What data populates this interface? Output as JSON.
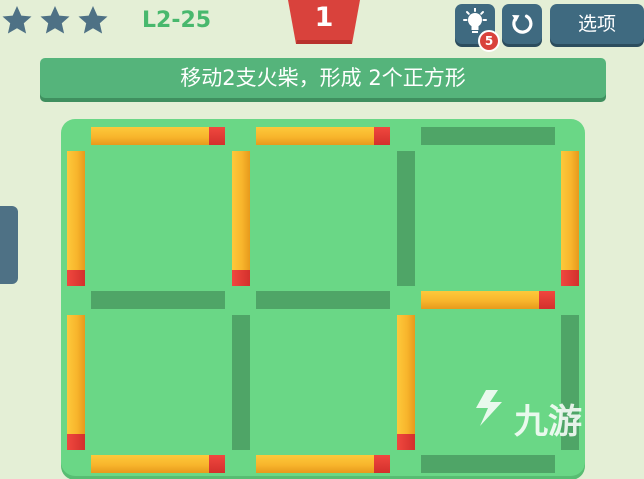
{
  "header": {
    "stars": [
      {
        "name": "star-1",
        "filled": true
      },
      {
        "name": "star-2",
        "filled": true
      },
      {
        "name": "star-3",
        "filled": true
      }
    ],
    "level": "L2-25",
    "moves": "1",
    "hint_count": "5",
    "options_label": "选项"
  },
  "instruction": "移动2支火柴，形成 2个正方形",
  "watermark": "九游",
  "colors": {
    "background": "#e4efd6",
    "star": "#4e7185",
    "level_text": "#48b86d",
    "move_banner": "#d9423c",
    "button": "#3f6a80",
    "instruction_bar": "#55b47b",
    "board": "#6ad786",
    "empty_slot": "#4fa567",
    "match_body": "#f8b52c",
    "match_head": "#d3302c"
  },
  "board": {
    "grid": "3x2",
    "matches": [
      {
        "id": "top-1",
        "orientation": "h",
        "present": true
      },
      {
        "id": "top-2",
        "orientation": "h",
        "present": true
      },
      {
        "id": "top-3",
        "orientation": "h",
        "present": false
      },
      {
        "id": "left-col0-row0",
        "orientation": "v",
        "present": true
      },
      {
        "id": "left-col1-row0",
        "orientation": "v",
        "present": true
      },
      {
        "id": "left-col2-row0",
        "orientation": "v",
        "present": false
      },
      {
        "id": "left-col3-row0",
        "orientation": "v",
        "present": true
      },
      {
        "id": "mid-1",
        "orientation": "h",
        "present": false
      },
      {
        "id": "mid-2",
        "orientation": "h",
        "present": false
      },
      {
        "id": "mid-3",
        "orientation": "h",
        "present": true
      },
      {
        "id": "left-col0-row1",
        "orientation": "v",
        "present": true
      },
      {
        "id": "left-col1-row1",
        "orientation": "v",
        "present": false
      },
      {
        "id": "left-col2-row1",
        "orientation": "v",
        "present": true
      },
      {
        "id": "left-col3-row1",
        "orientation": "v",
        "present": false
      },
      {
        "id": "bottom-1",
        "orientation": "h",
        "present": true
      },
      {
        "id": "bottom-2",
        "orientation": "h",
        "present": true
      },
      {
        "id": "bottom-3",
        "orientation": "h",
        "present": false
      }
    ]
  }
}
